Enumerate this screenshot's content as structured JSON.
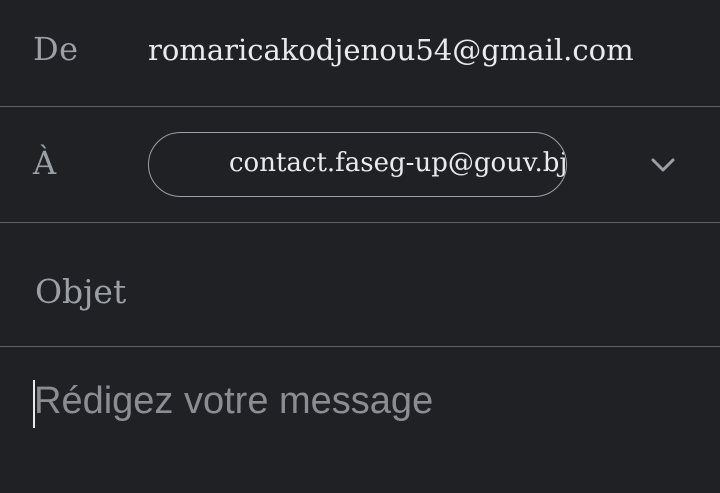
{
  "from": {
    "label": "De",
    "value": "romaricakodjenou54@gmail.com"
  },
  "to": {
    "label": "À",
    "recipient": "contact.faseg-up@gouv.bj",
    "expand_icon": "chevron-down-icon"
  },
  "subject": {
    "placeholder": "Objet",
    "value": ""
  },
  "body": {
    "placeholder": "Rédigez votre message",
    "value": ""
  },
  "colors": {
    "background": "#202124",
    "text": "#e8eaed",
    "muted": "#9aa0a6",
    "divider": "#5f6368"
  }
}
